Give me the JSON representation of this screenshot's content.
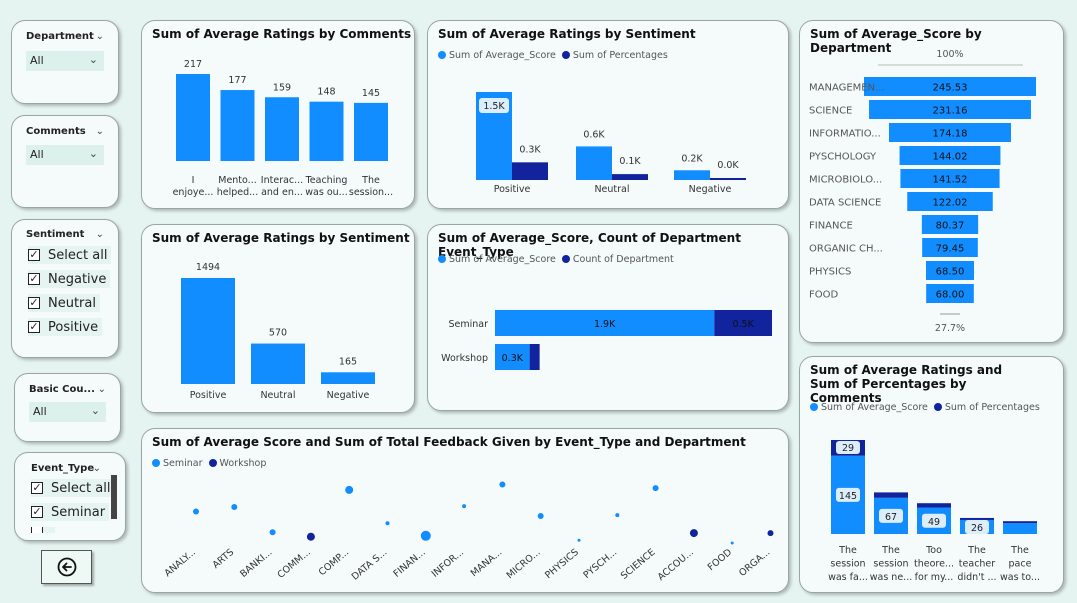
{
  "colors": {
    "primary": "#118dff",
    "secondary": "#12239e",
    "bg": "#e6f4f1"
  },
  "slicers": {
    "department": {
      "title": "Department",
      "value": "All"
    },
    "comments": {
      "title": "Comments",
      "value": "All"
    },
    "sentiment": {
      "title": "Sentiment",
      "items": [
        "Select all",
        "Negative",
        "Neutral",
        "Positive"
      ]
    },
    "basic": {
      "title": "Basic Cou...",
      "value": "All"
    },
    "event_type": {
      "title": "Event_Type",
      "items": [
        "Select all",
        "Seminar"
      ]
    }
  },
  "back_button": {
    "icon": "arrow-left-circle-icon"
  },
  "chart_data": [
    {
      "id": "c1",
      "type": "bar",
      "title": "Sum of Average Ratings by Comments",
      "categories": [
        [
          "I",
          "enjoye..."
        ],
        [
          "Mento...",
          "helped..."
        ],
        [
          "Interac...",
          "and en..."
        ],
        [
          "Teaching",
          "was ou..."
        ],
        [
          "The",
          "session..."
        ]
      ],
      "values": [
        217,
        177,
        159,
        148,
        145
      ],
      "labels": [
        "217",
        "177",
        "159",
        "148",
        "145"
      ]
    },
    {
      "id": "c2",
      "type": "bar",
      "title": "Sum of Average Ratings by Sentiment",
      "legend": [
        "Sum of Average_Score",
        "Sum of Percentages"
      ],
      "categories": [
        "Positive",
        "Neutral",
        "Negative"
      ],
      "series": [
        {
          "name": "Sum of Average_Score",
          "values": [
            1494,
            570,
            165
          ],
          "labels": [
            "1.5K",
            "0.6K",
            "0.2K"
          ]
        },
        {
          "name": "Sum of Percentages",
          "values": [
            300,
            100,
            20
          ],
          "labels": [
            "0.3K",
            "0.1K",
            "0.0K"
          ]
        }
      ]
    },
    {
      "id": "c3",
      "type": "bar",
      "title": "Sum of Average_Score by Department",
      "top_label": "100%",
      "bottom_label": "27.7%",
      "categories": [
        "MANAGEMEN...",
        "SCIENCE",
        "INFORMATIO...",
        "PYSCHOLOGY",
        "MICROBIOLO...",
        "DATA SCIENCE",
        "FINANCE",
        "ORGANIC CH...",
        "PHYSICS",
        "FOOD"
      ],
      "values": [
        245.53,
        231.16,
        174.18,
        144.02,
        141.52,
        122.02,
        80.37,
        79.45,
        68.5,
        68.0
      ],
      "labels": [
        "245.53",
        "231.16",
        "174.18",
        "144.02",
        "141.52",
        "122.02",
        "80.37",
        "79.45",
        "68.50",
        "68.00"
      ]
    },
    {
      "id": "c4",
      "type": "bar",
      "title": "Sum of Average Ratings by Sentiment",
      "categories": [
        "Positive",
        "Neutral",
        "Negative"
      ],
      "values": [
        1494,
        570,
        165
      ],
      "labels": [
        "1494",
        "570",
        "165"
      ]
    },
    {
      "id": "c5",
      "type": "bar",
      "title": "Sum of Average_Score, Count of Department Event_Type",
      "legend": [
        "Sum of Average_Score",
        "Count of Department"
      ],
      "categories": [
        "Seminar",
        "Workshop"
      ],
      "series": [
        {
          "name": "Sum of Average_Score",
          "values": [
            1900,
            300
          ],
          "labels": [
            "1.9K",
            "0.3K"
          ]
        },
        {
          "name": "Count of Department",
          "values": [
            500,
            100
          ],
          "labels": [
            "0.5K",
            ""
          ]
        }
      ]
    },
    {
      "id": "c6",
      "type": "bar",
      "title": "Sum of Average Ratings and Sum of Percentages by Comments",
      "legend": [
        "Sum of Average_Score",
        "Sum of Percentages"
      ],
      "categories": [
        [
          "The",
          "session",
          "was fa..."
        ],
        [
          "The",
          "session",
          "was ne..."
        ],
        [
          "Too",
          "theore...",
          "for my..."
        ],
        [
          "The",
          "teacher",
          "didn't ..."
        ],
        [
          "The",
          "pace",
          "was to..."
        ]
      ],
      "series": [
        {
          "name": "Sum of Average_Score",
          "values": [
            145,
            67,
            49,
            26,
            20
          ],
          "labels": [
            "145",
            "67",
            "49",
            "26",
            ""
          ]
        },
        {
          "name": "Sum of Percentages",
          "values": [
            29,
            10,
            8,
            3,
            2
          ],
          "labels": [
            "29",
            "",
            "",
            "",
            ""
          ]
        }
      ]
    },
    {
      "id": "c7",
      "type": "scatter",
      "title": "Sum of Average Score and Sum of Total Feedback Given by Event_Type and Department",
      "legend": [
        "Seminar",
        "Workshop"
      ],
      "categories": [
        "ANALY...",
        "ARTS",
        "BANKI...",
        "COMM...",
        "COMP...",
        "DATA S...",
        "FINAN...",
        "INFOR...",
        "MANA...",
        "MICRO...",
        "PHYSICS",
        "PYSCH...",
        "SCIENCE",
        "ACCOU...",
        "FOOD",
        "ORGA..."
      ],
      "points": [
        {
          "series": "Seminar",
          "cat": 0,
          "y": 0.55,
          "size": 3
        },
        {
          "series": "Seminar",
          "cat": 1,
          "y": 0.6,
          "size": 3
        },
        {
          "series": "Seminar",
          "cat": 2,
          "y": 0.32,
          "size": 3
        },
        {
          "series": "Workshop",
          "cat": 3,
          "y": 0.27,
          "size": 4
        },
        {
          "series": "Seminar",
          "cat": 4,
          "y": 0.79,
          "size": 4
        },
        {
          "series": "Seminar",
          "cat": 5,
          "y": 0.42,
          "size": 2
        },
        {
          "series": "Seminar",
          "cat": 6,
          "y": 0.28,
          "size": 5
        },
        {
          "series": "Seminar",
          "cat": 7,
          "y": 0.61,
          "size": 2
        },
        {
          "series": "Seminar",
          "cat": 8,
          "y": 0.85,
          "size": 3
        },
        {
          "series": "Seminar",
          "cat": 9,
          "y": 0.5,
          "size": 3
        },
        {
          "series": "Seminar",
          "cat": 10,
          "y": 0.23,
          "size": 1.5
        },
        {
          "series": "Seminar",
          "cat": 11,
          "y": 0.51,
          "size": 2
        },
        {
          "series": "Seminar",
          "cat": 12,
          "y": 0.81,
          "size": 3
        },
        {
          "series": "Workshop",
          "cat": 13,
          "y": 0.31,
          "size": 4
        },
        {
          "series": "Seminar",
          "cat": 14,
          "y": 0.2,
          "size": 1.5
        },
        {
          "series": "Workshop",
          "cat": 15,
          "y": 0.31,
          "size": 3
        }
      ]
    }
  ]
}
